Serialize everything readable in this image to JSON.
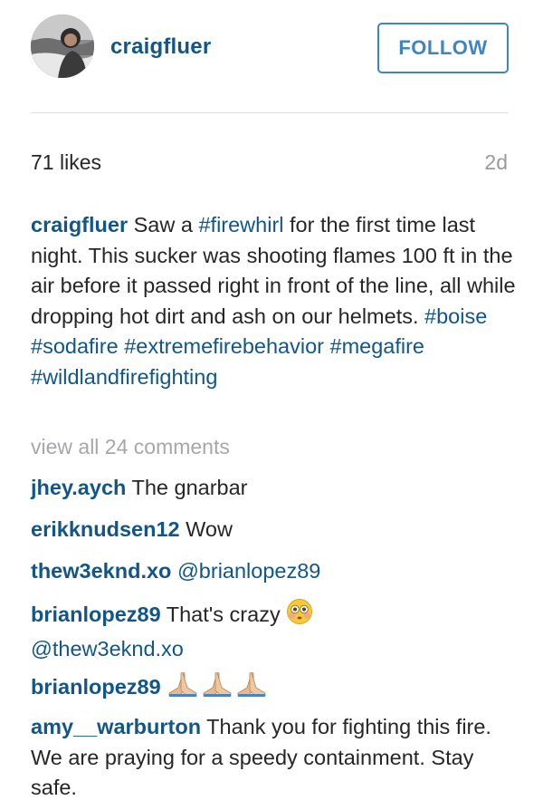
{
  "post": {
    "username": "craigfluer",
    "follow_label": "FOLLOW",
    "likes": "71 likes",
    "time": "2d",
    "caption": {
      "username": "craigfluer",
      "text_1": " Saw a ",
      "tag_firewhirl": "#firewhirl",
      "text_2": " for the first time last night. This sucker was shooting flames 100 ft in the air before it passed right in front of the line, all while dropping hot dirt and ash on our helmets. ",
      "tag_boise": "#boise",
      "tag_sodafire": "#sodafire",
      "tag_extreme": "#extremefirebehavior",
      "tag_megafire": "#megafire",
      "tag_wildland": "#wildlandfirefighting"
    },
    "view_all": "view all 24 comments"
  },
  "comments": [
    {
      "user": "jhey.aych",
      "text": " The gnarbar"
    },
    {
      "user": "erikknudsen12",
      "text": " Wow"
    },
    {
      "user": "thew3eknd.xo",
      "mention": "@brianlopez89"
    },
    {
      "user": "brianlopez89",
      "text": " That's crazy ",
      "emoji": "flushed-face",
      "mention": "@thew3eknd.xo"
    },
    {
      "user": "brianlopez89",
      "emoji": "folded-hands x3"
    },
    {
      "user": "amy__warburton",
      "text": " Thank you for fighting this fire. We are praying for a speedy containment. Stay safe."
    }
  ],
  "colors": {
    "username_blue": "#125688",
    "follow_blue": "#3d85c6",
    "muted_gray": "#9a9a9a"
  }
}
